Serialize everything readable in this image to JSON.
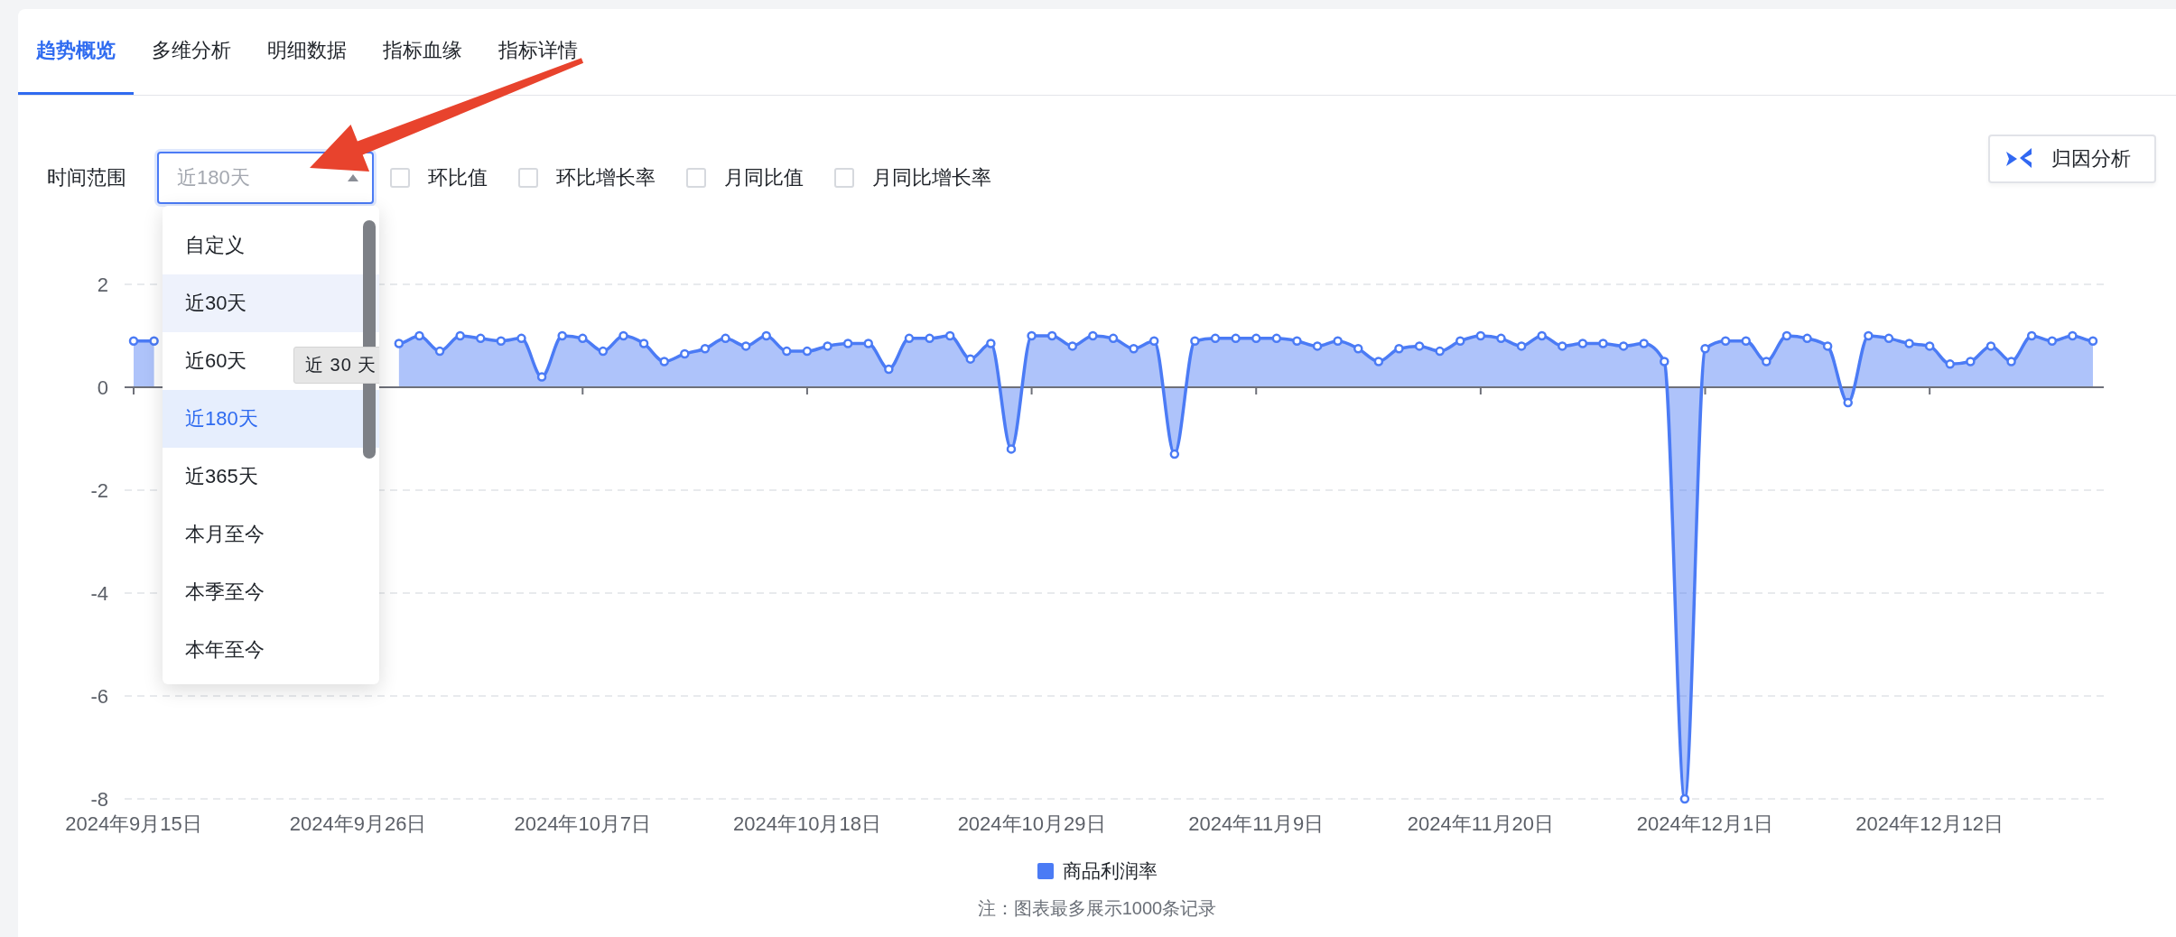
{
  "tabs": [
    {
      "label": "趋势概览",
      "selected": true
    },
    {
      "label": "多维分析",
      "selected": false
    },
    {
      "label": "明细数据",
      "selected": false
    },
    {
      "label": "指标血缘",
      "selected": false
    },
    {
      "label": "指标详情",
      "selected": false
    }
  ],
  "filters": {
    "label": "时间范围",
    "select": {
      "placeholder": "近180天",
      "open": true
    },
    "checkboxes": [
      {
        "label": "环比值",
        "checked": false
      },
      {
        "label": "环比增长率",
        "checked": false
      },
      {
        "label": "月同比值",
        "checked": false
      },
      {
        "label": "月同比增长率",
        "checked": false
      }
    ]
  },
  "attribution_button": {
    "label": "归因分析"
  },
  "dropdown": {
    "options": [
      {
        "label": "自定义",
        "selected": false,
        "hovered": false
      },
      {
        "label": "近30天",
        "selected": false,
        "hovered": true
      },
      {
        "label": "近60天",
        "selected": false,
        "hovered": false
      },
      {
        "label": "近180天",
        "selected": true,
        "hovered": false
      },
      {
        "label": "近365天",
        "selected": false,
        "hovered": false
      },
      {
        "label": "本月至今",
        "selected": false,
        "hovered": false
      },
      {
        "label": "本季至今",
        "selected": false,
        "hovered": false
      },
      {
        "label": "本年至今",
        "selected": false,
        "hovered": false
      }
    ],
    "tooltip": "近 30 天"
  },
  "chart": {
    "chart_data": {
      "type": "area",
      "grid": true,
      "ylim": [
        -8,
        2
      ],
      "yticks": [
        2,
        0,
        -2,
        -4,
        -6,
        -8
      ],
      "categories": [
        "2024年9月15日",
        null,
        null,
        null,
        null,
        null,
        null,
        null,
        null,
        null,
        null,
        "2024年9月26日",
        null,
        null,
        null,
        null,
        null,
        null,
        null,
        null,
        null,
        null,
        "2024年10月7日",
        null,
        null,
        null,
        null,
        null,
        null,
        null,
        null,
        null,
        null,
        "2024年10月18日",
        null,
        null,
        null,
        null,
        null,
        null,
        null,
        null,
        null,
        null,
        "2024年10月29日",
        null,
        null,
        null,
        null,
        null,
        null,
        null,
        null,
        null,
        null,
        "2024年11月9日",
        null,
        null,
        null,
        null,
        null,
        null,
        null,
        null,
        null,
        null,
        "2024年11月20日",
        null,
        null,
        null,
        null,
        null,
        null,
        null,
        null,
        null,
        null,
        "2024年12月1日",
        null,
        null,
        null,
        null,
        null,
        null,
        null,
        null,
        null,
        null,
        "2024年12月12日",
        null,
        null,
        null,
        null,
        null,
        null,
        null,
        null
      ],
      "series": [
        {
          "name": "商品利润率",
          "color": "#4b7bf5",
          "values": [
            0.9,
            0.9,
            null,
            null,
            null,
            null,
            null,
            null,
            null,
            null,
            null,
            null,
            null,
            0.85,
            1.0,
            0.7,
            1.0,
            0.95,
            0.9,
            0.95,
            0.2,
            1.0,
            0.95,
            0.7,
            1.0,
            0.85,
            0.5,
            0.65,
            0.75,
            0.95,
            0.8,
            1.0,
            0.7,
            0.7,
            0.8,
            0.85,
            0.85,
            0.35,
            0.95,
            0.95,
            1.0,
            0.55,
            0.85,
            -1.2,
            1.0,
            1.0,
            0.8,
            1.0,
            0.95,
            0.75,
            0.9,
            -1.3,
            0.9,
            0.95,
            0.95,
            0.95,
            0.95,
            0.9,
            0.8,
            0.9,
            0.75,
            0.5,
            0.75,
            0.8,
            0.7,
            0.9,
            1.0,
            0.95,
            0.8,
            1.0,
            0.8,
            0.85,
            0.85,
            0.8,
            0.85,
            0.5,
            -8.0,
            0.75,
            0.9,
            0.9,
            0.5,
            1.0,
            0.95,
            0.8,
            -0.3,
            1.0,
            0.95,
            0.85,
            0.8,
            0.45,
            0.5,
            0.8,
            0.5,
            1.0,
            0.9,
            1.0,
            0.9
          ]
        }
      ]
    },
    "note": "注：图表最多展示1000条记录"
  }
}
